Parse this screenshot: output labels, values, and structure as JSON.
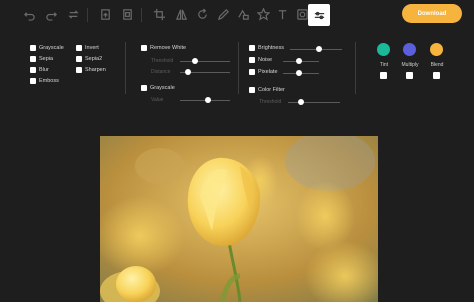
{
  "toolbar": {
    "icons": [
      "undo-icon",
      "redo-icon",
      "history-icon",
      "mask-icon",
      "frame-icon",
      "crop-icon",
      "flip-icon",
      "rotate-icon",
      "draw-icon",
      "shape-icon",
      "star-icon",
      "text-icon",
      "filter-icon",
      "adjust-icon"
    ],
    "download_label": "Download"
  },
  "filters": {
    "grayscale": "Grayscale",
    "invert": "Invert",
    "sepia": "Sepia",
    "sepia2": "Sepia2",
    "blur": "Blur",
    "sharpen": "Sharpen",
    "emboss": "Emboss",
    "remove_white": "Remove White",
    "threshold_label": "Threshold",
    "distance_label": "Distance",
    "grayscale2": "Grayscale",
    "value_label": "Value",
    "brightness": "Brightness",
    "noise": "Noise",
    "pixelate": "Pixelate",
    "color_filter": "Color Filter",
    "threshold2_label": "Threshold"
  },
  "sliders": {
    "threshold": 0.3,
    "distance": 0.15,
    "value": 0.55,
    "brightness": 0.55,
    "noise": 0.45,
    "pixelate": 0.45,
    "color_threshold": 0.25
  },
  "blend": {
    "tint": {
      "label": "Tint",
      "color": "#19b99a"
    },
    "multiply": {
      "label": "Multiply",
      "color": "#5b5fdb"
    },
    "blend": {
      "label": "Blend",
      "color": "#f6b33e"
    }
  },
  "colors": {
    "accent": "#f6b33e",
    "background": "#1e1e1e"
  }
}
